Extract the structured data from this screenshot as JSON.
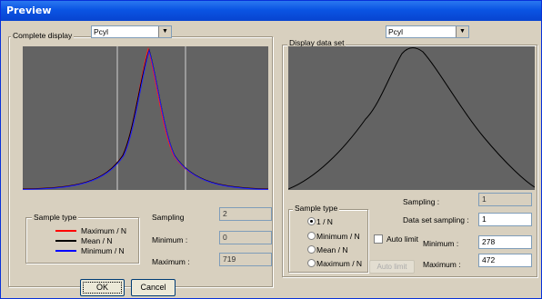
{
  "window": {
    "title": "Preview"
  },
  "left": {
    "combo_value": "Pcyl",
    "group_title": "Complete display",
    "sample_type": {
      "title": "Sample type",
      "items": [
        {
          "label": "Maximum / N",
          "color": "#ff0000"
        },
        {
          "label": "Mean / N",
          "color": "#000000"
        },
        {
          "label": "Minimum / N",
          "color": "#0000ff"
        }
      ]
    },
    "sampling": {
      "label": "Sampling",
      "value": "2"
    },
    "minimum": {
      "label": "Minimum :",
      "value": "0"
    },
    "maximum": {
      "label": "Maximum :",
      "value": "719"
    }
  },
  "right": {
    "combo_value": "Pcyl",
    "group_title": "Display data set",
    "sample_type": {
      "title": "Sample type",
      "options": [
        "1 / N",
        "Minimum / N",
        "Mean / N",
        "Maximum / N"
      ],
      "selected": "1 / N"
    },
    "sampling": {
      "label": "Sampling :",
      "value": "1"
    },
    "data_set_sampling": {
      "label": "Data set sampling :",
      "value": "1"
    },
    "auto_limit_label": "Auto limit",
    "auto_limit_checked": false,
    "minimum": {
      "label": "Minimum :",
      "value": "278"
    },
    "maximum": {
      "label": "Maximum :",
      "value": "472"
    },
    "auto_limit_button": "Auto limit"
  },
  "buttons": {
    "ok": "OK",
    "cancel": "Cancel"
  },
  "colors": {
    "plot_bg": "#636363",
    "titlebar": "#0a54e3"
  }
}
